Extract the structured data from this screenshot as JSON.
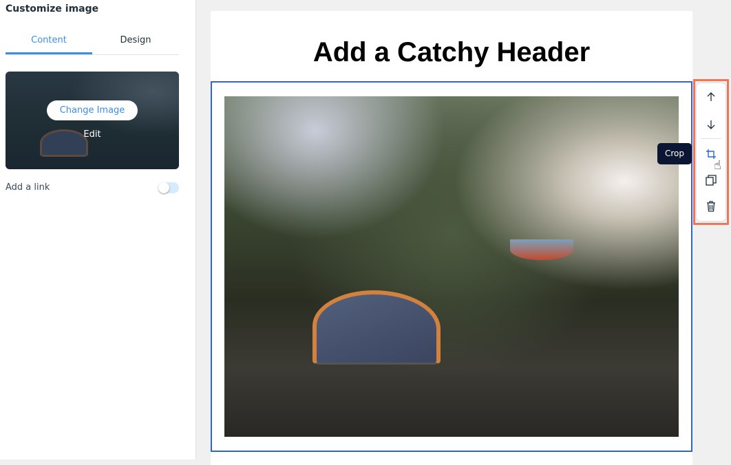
{
  "sidebar": {
    "title": "Customize image",
    "tabs": [
      {
        "label": "Content",
        "active": true
      },
      {
        "label": "Design",
        "active": false
      }
    ],
    "thumbnail": {
      "change_label": "Change Image",
      "edit_label": "Edit"
    },
    "link": {
      "label": "Add a link",
      "enabled": false
    }
  },
  "canvas": {
    "header": "Add a Catchy Header"
  },
  "toolbar": {
    "items": [
      "arrow-up-icon",
      "arrow-down-icon",
      "crop-icon",
      "duplicate-icon",
      "trash-icon"
    ],
    "tooltip": "Crop"
  },
  "colors": {
    "accent": "#3b8ee6",
    "selection": "#2b63d9",
    "toolbar_outline": "#f27656",
    "tooltip_bg": "#0b1633"
  }
}
